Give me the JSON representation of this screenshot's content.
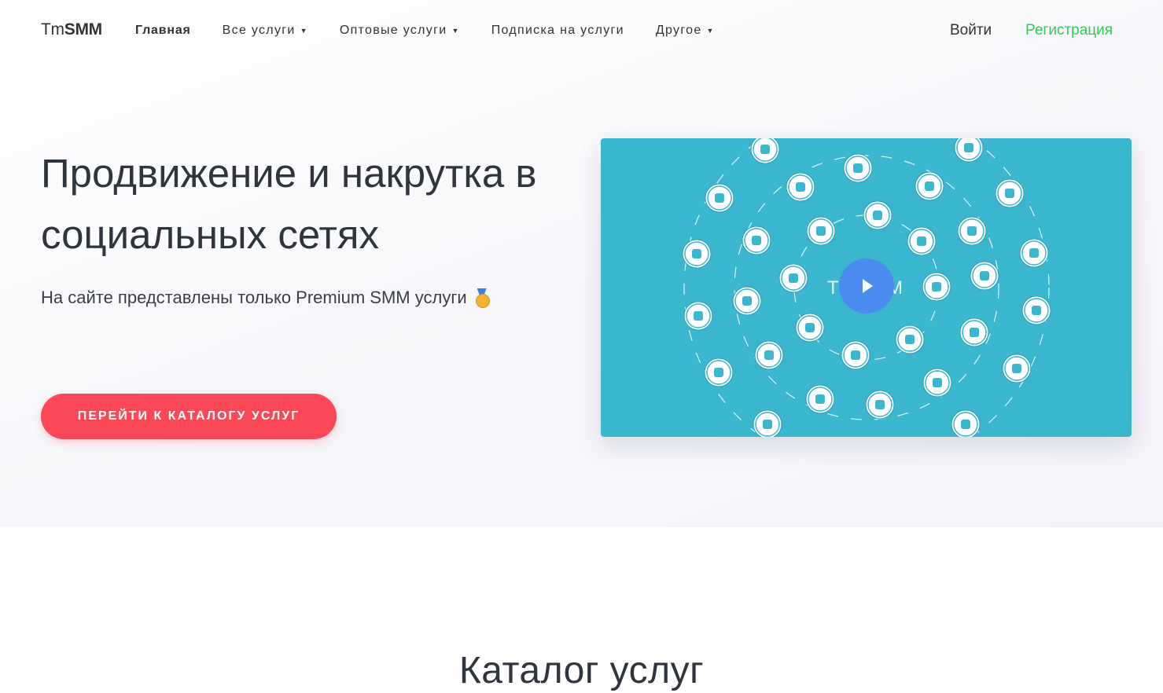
{
  "header": {
    "logo_light": "Tm",
    "logo_bold": "SMM",
    "nav": [
      {
        "label": "Главная",
        "dropdown": false,
        "active": true
      },
      {
        "label": "Все услуги",
        "dropdown": true,
        "active": false
      },
      {
        "label": "Оптовые услуги",
        "dropdown": true,
        "active": false
      },
      {
        "label": "Подписка на услуги",
        "dropdown": false,
        "active": false
      },
      {
        "label": "Другое",
        "dropdown": true,
        "active": false
      }
    ],
    "login_label": "Войти",
    "register_label": "Регистрация"
  },
  "hero": {
    "title_line1": "Продвижение и накрутка в",
    "title_line2": "социальных сетях",
    "subtitle": "На сайте представлены только Premium SMM услуги",
    "subtitle_icon": "medal-icon",
    "cta_label": "ПЕРЕЙТИ К КАТАЛОГУ УСЛУГ",
    "video_watermark_left": "T",
    "video_watermark_right": "M"
  },
  "catalog": {
    "title": "Каталог услуг"
  },
  "colors": {
    "accent_green": "#35c757",
    "cta_red": "#fb4857",
    "video_bg": "#3bb6cf",
    "play_blue": "#4a8cf0"
  }
}
